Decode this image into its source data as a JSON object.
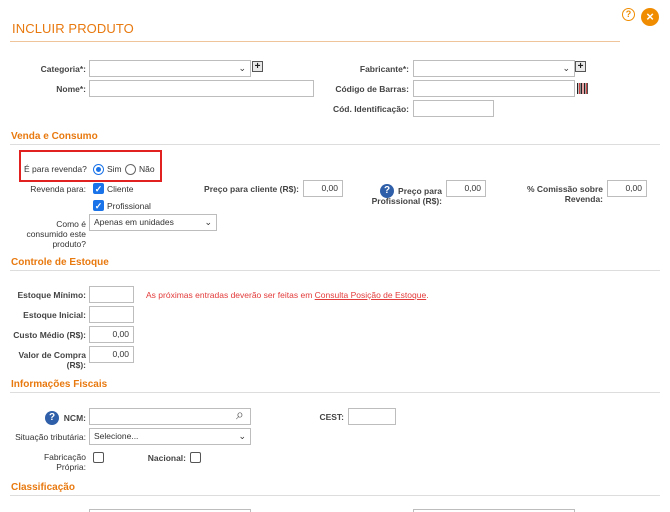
{
  "header": {
    "title": "INCLUIR PRODUTO",
    "help_glyph": "?",
    "close_glyph": "×"
  },
  "produto": {
    "categoria_label": "Categoria*:",
    "categoria_value": "",
    "fabricante_label": "Fabricante*:",
    "fabricante_value": "",
    "nome_label": "Nome*:",
    "nome_value": "",
    "codigo_barras_label": "Código de Barras:",
    "codigo_barras_value": "",
    "cod_identificacao_label": "Cód. Identificação:",
    "cod_identificacao_value": "",
    "plus_glyph": "+"
  },
  "venda": {
    "section_title": "Venda e Consumo",
    "revenda_question": "É para revenda?",
    "sim_label": "Sim",
    "nao_label": "Não",
    "revenda_para_label": "Revenda para:",
    "cliente_label": "Cliente",
    "profissional_label": "Profissional",
    "preco_cliente_label": "Preço para cliente (R$):",
    "preco_cliente_value": "0,00",
    "preco_profissional_label": "Preço para Profissional (R$):",
    "preco_profissional_value": "0,00",
    "comissao_label": "% Comissão sobre Revenda:",
    "comissao_value": "0,00",
    "consumido_label": "Como é consumido este produto?",
    "consumido_value": "Apenas em unidades",
    "check_glyph": "✓",
    "help_glyph": "?"
  },
  "estoque": {
    "section_title": "Controle de Estoque",
    "minimo_label": "Estoque Mínimo:",
    "minimo_value": "",
    "inicial_label": "Estoque Inicial:",
    "inicial_value": "",
    "custo_label": "Custo Médio (R$):",
    "custo_value": "0,00",
    "compra_label": "Valor de Compra (R$):",
    "compra_value": "0,00",
    "notice_text": "As próximas entradas deverão ser feitas em ",
    "notice_link": "Consulta Posição de Estoque",
    "notice_end": "."
  },
  "fiscal": {
    "section_title": "Informações Fiscais",
    "ncm_label": "NCM:",
    "ncm_value": "",
    "cest_label": "CEST:",
    "cest_value": "",
    "situacao_label": "Situação tributária:",
    "situacao_value": "Selecione...",
    "fabricacao_label": "Fabricação Própria:",
    "nacional_label": "Nacional:",
    "help_glyph": "?",
    "search_glyph": "⌕"
  },
  "classificacao": {
    "section_title": "Classificação"
  },
  "icons": {
    "chevron": "⌄"
  },
  "colors": {
    "accent": "#e8790f",
    "highlight_border": "#e12020",
    "check_blue": "#1a73e8",
    "help_blue": "#2f5fa8"
  }
}
